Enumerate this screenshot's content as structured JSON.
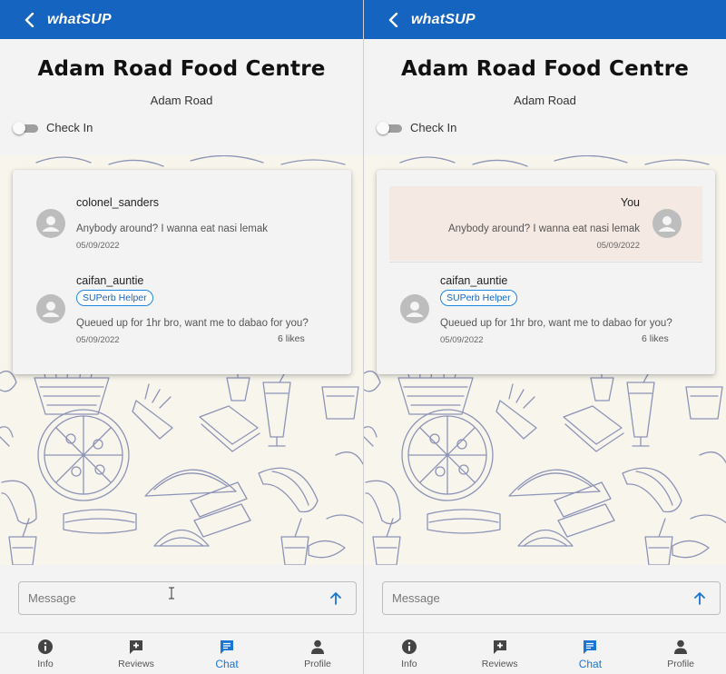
{
  "app": {
    "brand": "whatSUP"
  },
  "header": {
    "title": "Adam Road Food Centre",
    "subtitle": "Adam Road",
    "checkin_label": "Check In"
  },
  "composer": {
    "placeholder": "Message"
  },
  "nav": [
    "Info",
    "Reviews",
    "Chat",
    "Profile"
  ],
  "panels": [
    {
      "messages": [
        {
          "user": "colonel_sanders",
          "text": "Anybody around? I wanna eat nasi lemak",
          "date": "05/09/2022"
        },
        {
          "user": "caifan_auntie",
          "badge": "SUPerb Helper",
          "text": "Queued up for 1hr bro, want me to dabao for you?",
          "date": "05/09/2022",
          "likes": "6 likes"
        }
      ]
    },
    {
      "messages": [
        {
          "user": "You",
          "text": "Anybody around? I wanna eat nasi lemak",
          "date": "05/09/2022",
          "own": true
        },
        {
          "user": "caifan_auntie",
          "badge": "SUPerb Helper",
          "text": "Queued up for 1hr bro, want me to dabao for you?",
          "date": "05/09/2022",
          "likes": "6 likes"
        }
      ]
    }
  ],
  "colors": {
    "primary": "#1565c0",
    "active_nav": "#1976d2",
    "own_message_bg": "#f5e9e3",
    "doodle_bg": "#f8f6ec",
    "doodle_line": "#6a73a6"
  }
}
